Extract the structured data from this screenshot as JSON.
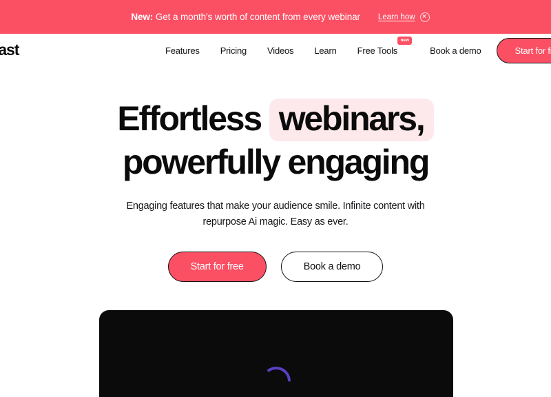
{
  "banner": {
    "label_bold": "New:",
    "text": " Get a month's worth of content from every webinar",
    "link_label": "Learn how",
    "close_icon": "close-circle-icon",
    "background_color": "#fb5064"
  },
  "header": {
    "logo_text": "ntrast",
    "nav_items": [
      {
        "label": "Features"
      },
      {
        "label": "Pricing"
      },
      {
        "label": "Videos"
      },
      {
        "label": "Learn"
      },
      {
        "label": "Free Tools",
        "badge": "new"
      }
    ],
    "demo_label": "Book a demo",
    "cta_label": "Start for free",
    "cta_color": "#fb5064",
    "badge_color": "#fb5064"
  },
  "hero": {
    "headline_part1": "Effortless",
    "headline_highlight": "webinars,",
    "headline_part2": "powerfully engaging",
    "highlight_color": "#fde9ec",
    "subhead_line1": "Engaging features that make your audience smile. Infinite content with",
    "subhead_line2": "repurpose Ai magic. Easy as ever.",
    "primary_cta": "Start for free",
    "secondary_cta": "Book a demo"
  },
  "media": {
    "panel_color": "#0b0b0b",
    "loader_icon": "circular-loader-icon",
    "loader_color": "#5b3fc4"
  }
}
